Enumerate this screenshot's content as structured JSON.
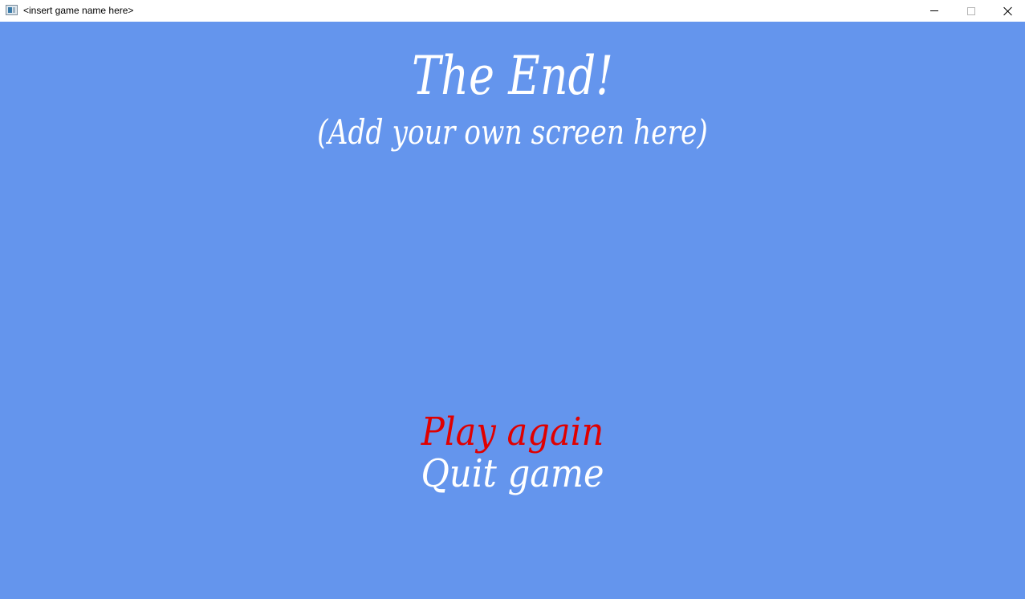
{
  "window": {
    "title": "<insert game name here>"
  },
  "screen": {
    "title": "The End!",
    "subtitle": "(Add your own screen here)"
  },
  "menu": {
    "items": [
      {
        "label": "Play again",
        "selected": true
      },
      {
        "label": "Quit game",
        "selected": false
      }
    ]
  },
  "colors": {
    "background": "#6495ed",
    "text": "#ffffff",
    "selected": "#e00000"
  },
  "icons": {
    "app": "app-window-icon",
    "minimize": "minimize-icon",
    "maximize": "maximize-icon",
    "close": "close-icon"
  }
}
